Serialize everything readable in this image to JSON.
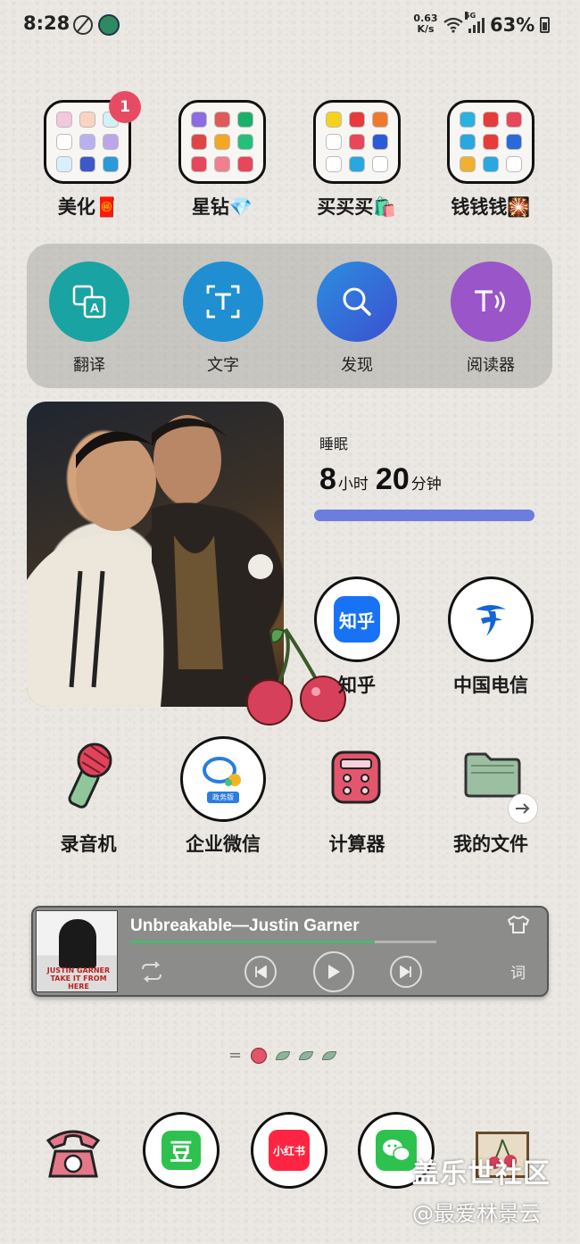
{
  "status_bar": {
    "time": "8:28",
    "speed_value": "0.63",
    "speed_unit": "K/s",
    "network": "5G",
    "battery": "63%"
  },
  "folders": [
    {
      "label": "美化🧧",
      "badge": "1"
    },
    {
      "label": "星钻💎"
    },
    {
      "label": "买买买🛍️"
    },
    {
      "label": "钱钱钱🎇"
    }
  ],
  "tools": [
    {
      "label": "翻译",
      "icon": "translate-icon",
      "color": "#1aa3a3"
    },
    {
      "label": "文字",
      "icon": "text-scan-icon",
      "color": "#1f8fd1"
    },
    {
      "label": "发现",
      "icon": "search-icon",
      "color": "#2f69d8"
    },
    {
      "label": "阅读器",
      "icon": "read-aloud-icon",
      "color": "#9a55c9"
    }
  ],
  "sleep": {
    "title": "睡眠",
    "hours": "8",
    "hours_unit": "小时",
    "minutes": "20",
    "minutes_unit": "分钟"
  },
  "apps_row1": [
    {
      "label": "知乎",
      "icon_text": "知乎"
    },
    {
      "label": "中国电信"
    }
  ],
  "apps_row2": [
    {
      "label": "录音机"
    },
    {
      "label": "企业微信",
      "icon_text": "政务版"
    },
    {
      "label": "计算器"
    },
    {
      "label": "我的文件"
    }
  ],
  "music": {
    "song": "Unbreakable—Justin Garner",
    "album_text": "JUSTIN GARNER TAKE IT FROM HERE",
    "lyrics_label": "词",
    "progress": 0.8
  },
  "dock": {
    "douban_text": "豆",
    "xiaohongshu_text": "小红书"
  },
  "watermark": {
    "line1": "盖乐世社区",
    "line2": "@最爱林景云"
  }
}
